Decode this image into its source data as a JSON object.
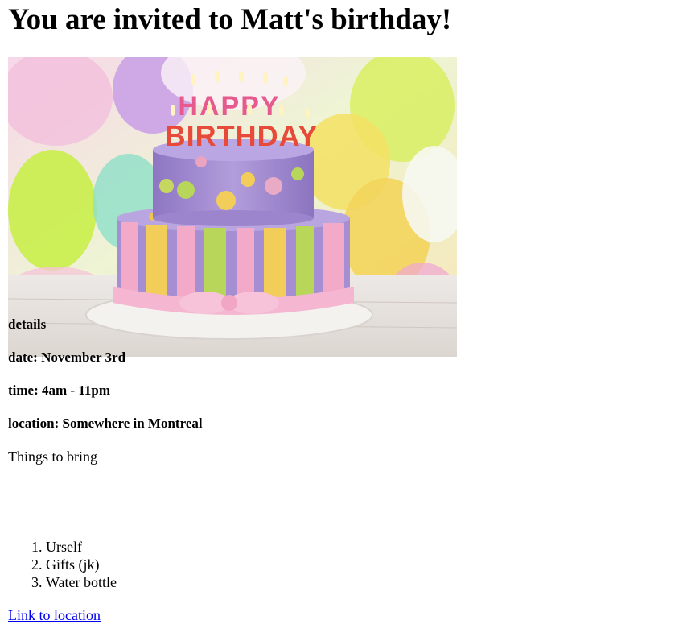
{
  "heading": "You are invited to Matt's birthday!",
  "image": {
    "description": "birthday cake",
    "candle_letters_top": "HAPPY",
    "candle_letters_bottom": "BIRTHDAY",
    "colors": {
      "purple": "#a48cd0",
      "pink": "#f3a9c8",
      "yellow": "#f3cd5a",
      "green": "#b7d65a",
      "board": "#f4f2ef"
    }
  },
  "details": {
    "heading": "details",
    "date": "date: November 3rd",
    "time": "time: 4am - 11pm",
    "location": "location: Somewhere in Montreal"
  },
  "bring": {
    "label": "Things to bring",
    "items": [
      "Urself",
      "Gifts (jk)",
      "Water bottle"
    ]
  },
  "link": {
    "label": "Link to location"
  }
}
